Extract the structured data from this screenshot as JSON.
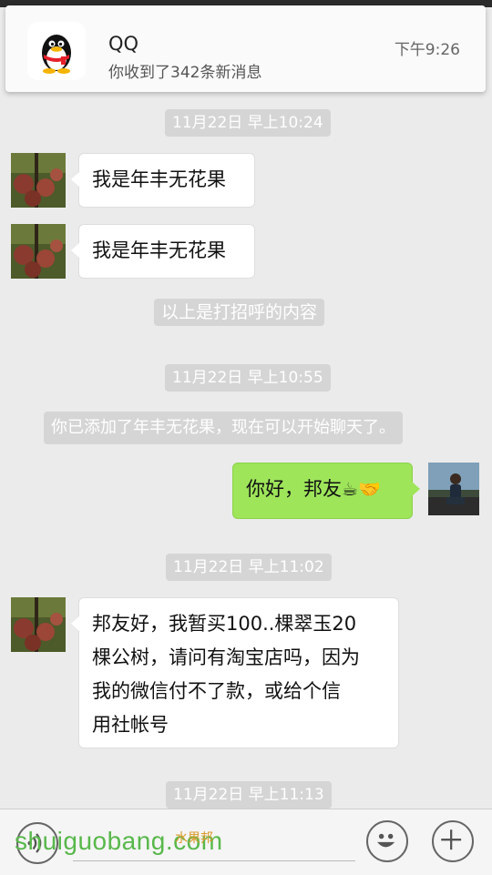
{
  "notification": {
    "app_name": "QQ",
    "message": "你收到了342条新消息",
    "time": "下午9:26",
    "icon": "qq-penguin-icon"
  },
  "chat": {
    "timestamps": [
      "11月22日 早上10:24",
      "11月22日 早上10:55",
      "11月22日 早上11:02",
      "11月22日 早上11:13"
    ],
    "messages": [
      {
        "text": "我是年丰无花果"
      },
      {
        "text": "我是年丰无花果"
      },
      {
        "text": "你好，邦友"
      },
      {
        "line1": "邦友好，我暂买100..棵翠玉20",
        "line2": "棵公树，请问有淘宝店吗，因为",
        "line3": "我的微信付不了款，或给个信",
        "line4": "用社帐号"
      }
    ],
    "system_notes": [
      "以上是打招呼的内容",
      "你已添加了年丰无花果，现在可以开始聊天了。"
    ],
    "emoji": {
      "coffee": "☕",
      "handshake": "🤝"
    }
  },
  "bottom_bar": {
    "voice_icon": "voice-icon",
    "emoji_icon": "smiley-icon",
    "plus_icon": "plus-icon"
  },
  "watermark": {
    "text": "shuiguobang.com",
    "cn": "水果邦"
  }
}
